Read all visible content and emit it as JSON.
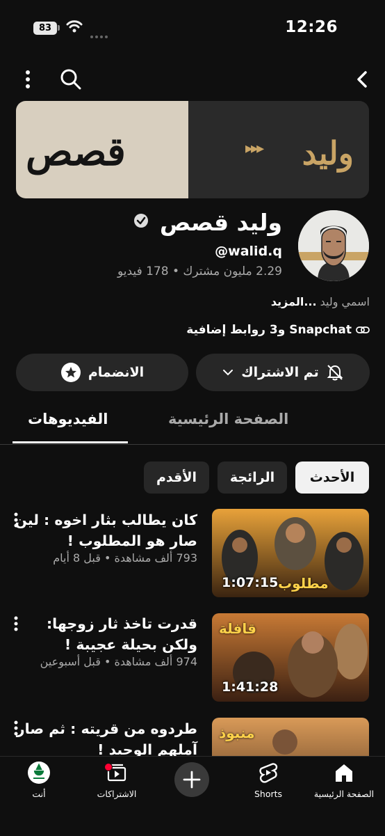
{
  "status_bar": {
    "time": "12:26",
    "battery": "83"
  },
  "header": {
    "back_icon": "chevron-right-icon",
    "search_icon": "search-icon",
    "more_icon": "more-vert-icon"
  },
  "banner": {
    "left_text": "قصص",
    "right_text": "وليد"
  },
  "channel": {
    "name": "وليد قصص",
    "handle": "@walid.q",
    "stats": "2.29 مليون مشترك • 178 فيديو",
    "description": "اسمي وليد",
    "more": "...المزيد",
    "links": "Snapchat و3 روابط إضافية"
  },
  "buttons": {
    "subscribed": "تم الاشتراك",
    "join": "الانضمام"
  },
  "tabs": {
    "home": "الصفحة الرئيسية",
    "videos": "الفيديوهات"
  },
  "chips": {
    "latest": "الأحدث",
    "popular": "الرائجة",
    "oldest": "الأقدم"
  },
  "videos": [
    {
      "title": "كان يطالب بثار اخوه : لين صار هو المطلوب !",
      "meta": "793 ألف مشاهدة • قبل 8 أيام",
      "duration": "1:07:15",
      "thumb_text": "مطلوب"
    },
    {
      "title": "قدرت تاخذ ثار زوجها: ولكن بحيلة عجيبة !",
      "meta": "974 ألف مشاهدة • قبل أسبوعين",
      "duration": "1:41:28",
      "thumb_text": "قافلة"
    },
    {
      "title": "طردوه من قريته : ثم صار آملهم الوحيد !",
      "meta": "",
      "duration": "",
      "thumb_text": "منبوذ"
    }
  ],
  "bottom_nav": {
    "home": "الصفحة الرئيسية",
    "shorts": "Shorts",
    "subscriptions": "الاشتراكات",
    "you": "أنت"
  },
  "colors": {
    "background": "#0f0f0f",
    "chip_active": "#f1f1f1",
    "button": "#272727",
    "notification": "#ff0033"
  }
}
